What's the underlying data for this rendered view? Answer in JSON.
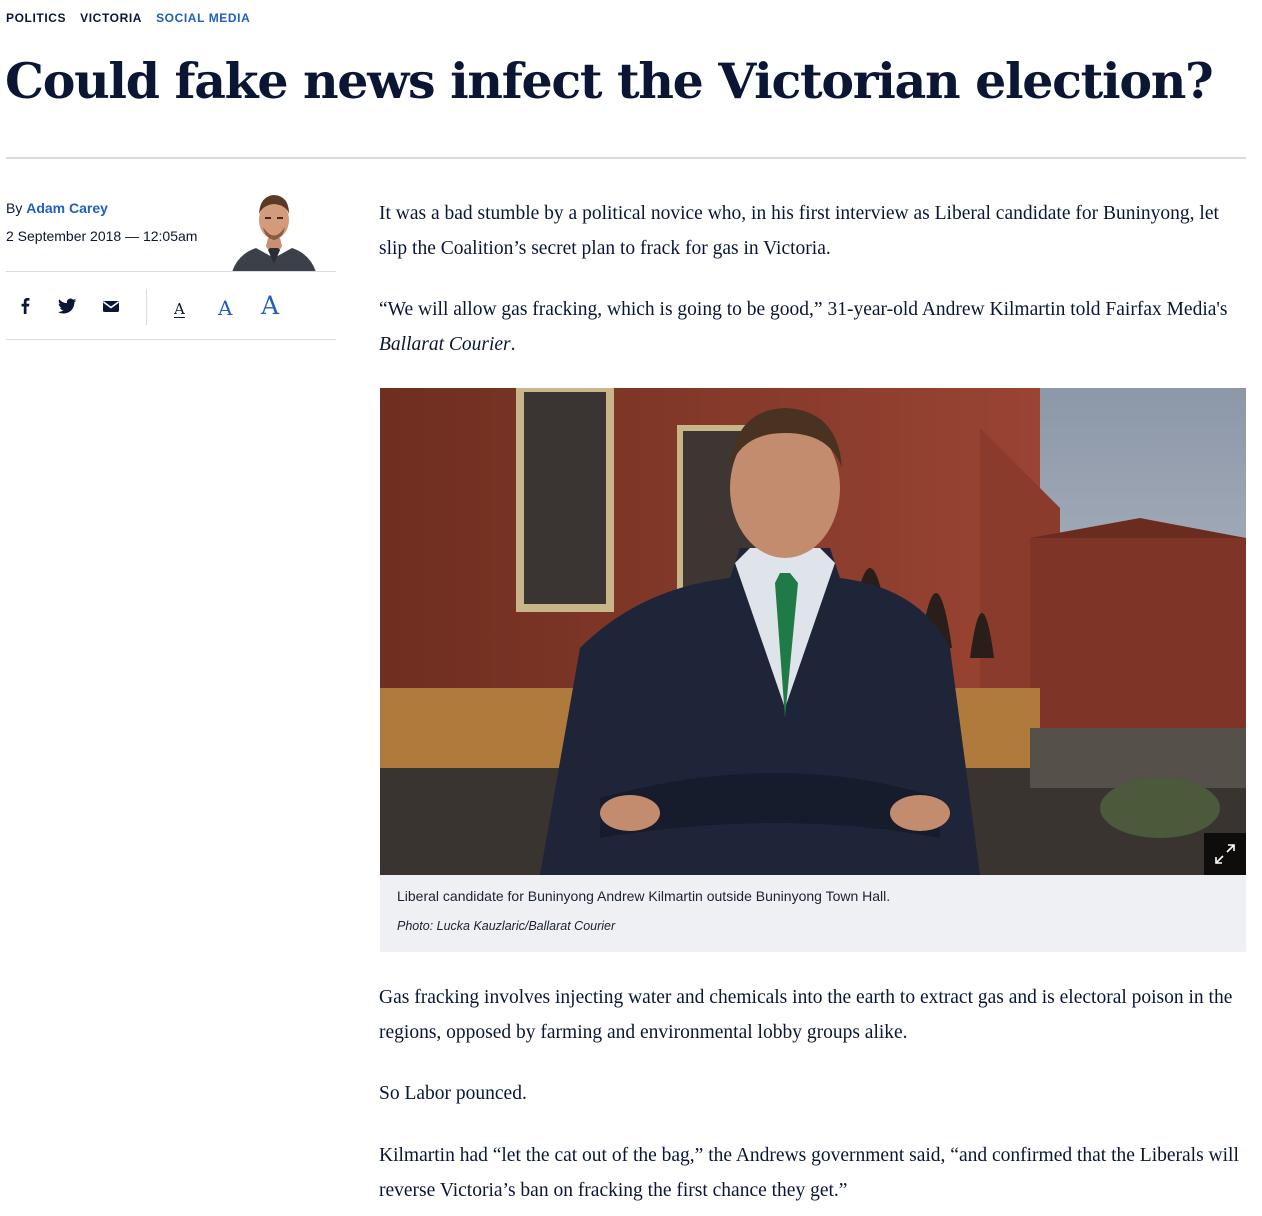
{
  "breadcrumbs": [
    "POLITICS",
    "VICTORIA",
    "SOCIAL MEDIA"
  ],
  "headline": "Could fake news infect the Victorian election?",
  "byline": {
    "prefix": "By",
    "author": "Adam Carey",
    "date": "2 September 2018 — 12:05am"
  },
  "share": {
    "icons": [
      "facebook-icon",
      "twitter-icon",
      "email-icon"
    ],
    "font_sizes": [
      "A",
      "A",
      "A"
    ]
  },
  "colors": {
    "accent": "#1f5fbf",
    "text": "#0a1633",
    "rule": "#d9dbe1",
    "caption_bg": "#eef0f4"
  },
  "article": {
    "p1": "It was a bad stumble by a political novice who, in his first interview as Liberal candidate for Buninyong, let slip the Coalition’s secret plan to frack for gas in Victoria.",
    "p2_main": "“We will allow gas fracking, which is going to be good,” 31-year-old Andrew Kilmartin told Fairfax Media's",
    "p2_pub": "Ballarat Courier",
    "p2_end": ".",
    "p3": "Gas fracking involves injecting water and chemicals into the earth to extract gas and is electoral poison in the regions, opposed by farming and environmental lobby groups alike.",
    "p4": "So Labor pounced.",
    "p5": "Kilmartin had “let the cat out of the bag,” the Andrews government said, “and confirmed that the Liberals will reverse Victoria’s ban on fracking the first chance they get.”"
  },
  "photo": {
    "caption": "Liberal candidate for Buninyong Andrew Kilmartin outside Buninyong Town Hall.",
    "credit": "Photo: Lucka Kauzlaric/Ballarat Courier"
  }
}
